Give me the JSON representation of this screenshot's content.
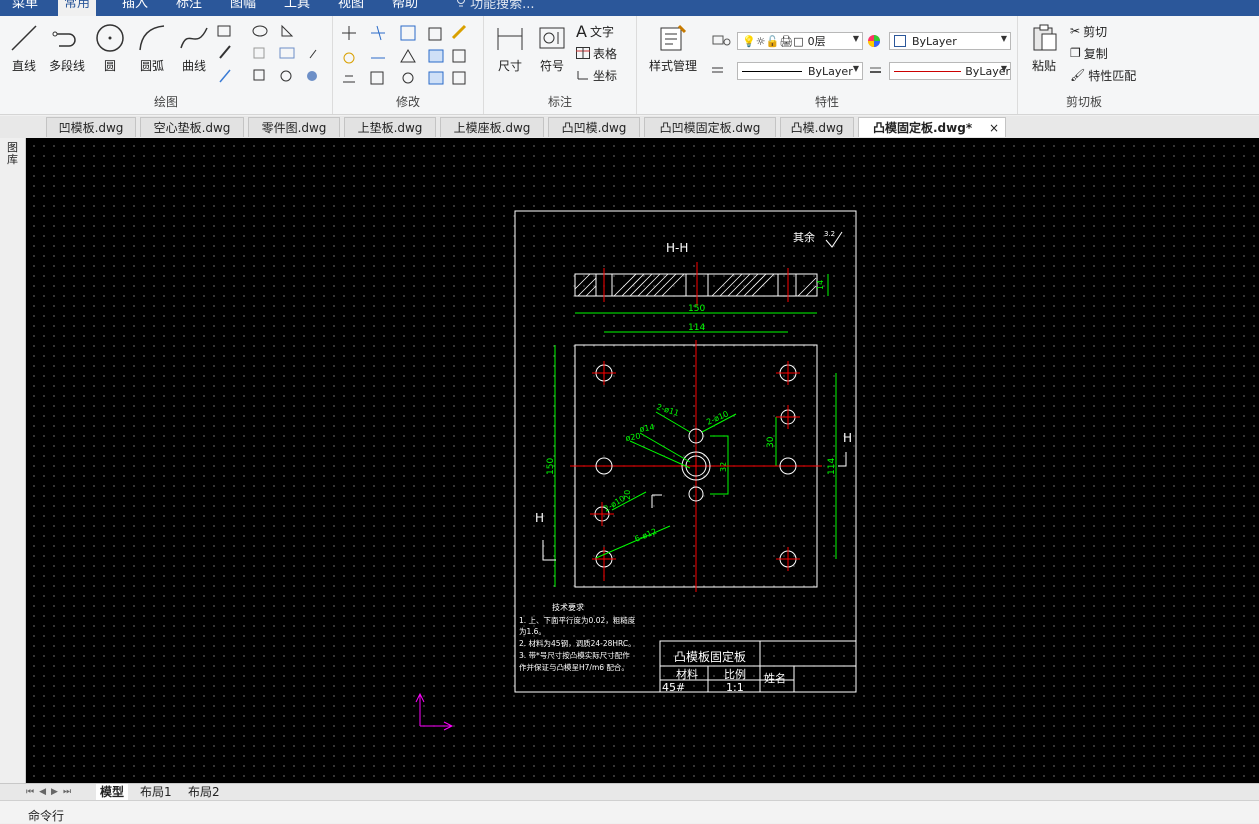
{
  "menu": [
    "菜单",
    "常用",
    "插入",
    "标注",
    "图幅",
    "工具",
    "视图",
    "帮助"
  ],
  "search_placeholder": "功能搜索...",
  "ribbon": {
    "draw": {
      "label": "绘图",
      "line": "直线",
      "polyline": "多段线",
      "circle": "圆",
      "arc": "圆弧",
      "curve": "曲线"
    },
    "modify": {
      "label": "修改"
    },
    "dim": {
      "label": "标注",
      "dimension": "尺寸",
      "symbol": "符号",
      "text": "文字",
      "table": "表格",
      "coord": "坐标"
    },
    "props": {
      "label": "特性",
      "style": "样式管理",
      "layer": "0层",
      "color": "ByLayer",
      "linetype": "ByLayer",
      "lineweight": "ByLayer"
    },
    "clip": {
      "label": "剪切板",
      "paste": "粘贴",
      "cut": "剪切",
      "copy": "复制",
      "match": "特性匹配"
    }
  },
  "tabs": [
    "凹模板.dwg",
    "空心垫板.dwg",
    "零件图.dwg",
    "上垫板.dwg",
    "上模座板.dwg",
    "凸凹模.dwg",
    "凸凹模固定板.dwg",
    "凸模.dwg",
    "凸模固定板.dwg*"
  ],
  "tab_close": "×",
  "left_strip_label": "图库",
  "layouts": [
    "模型",
    "布局1",
    "布局2"
  ],
  "command_label": "命令行",
  "drawing": {
    "section": "H-H",
    "roughness_note": "其余",
    "roughness_val": "3.2",
    "dims": {
      "d150": "150",
      "d114": "114",
      "d14": "14",
      "d_v150": "150",
      "d_v114": "114",
      "d30": "30",
      "d32": "32",
      "d20": "20",
      "h_letter": "H"
    },
    "callouts": [
      "2-ø11",
      "2-ø10",
      "ø14",
      "ø20",
      "2-ø10",
      "6-ø12"
    ],
    "notes_title": "技术要求",
    "notes": [
      "1. 上、下面平行度为0.02，粗糙度",
      "为1.6。",
      "2. 材料为45钢，调质24-28HRC。",
      "3. 带*号尺寸按凸模实际尺寸配作",
      "作并保证与凸模呈H7/m6 配合。"
    ],
    "title_block": {
      "name": "凸模板固定板",
      "material_label": "材料",
      "scale_label": "比例",
      "material": "45#",
      "scale": "1:1",
      "author_label": "姓名"
    }
  },
  "colors": {
    "accent": "#2b579a",
    "green": "#00ff00",
    "red": "#ff0000",
    "white": "#ffffff",
    "magenta": "#ff00ff"
  }
}
